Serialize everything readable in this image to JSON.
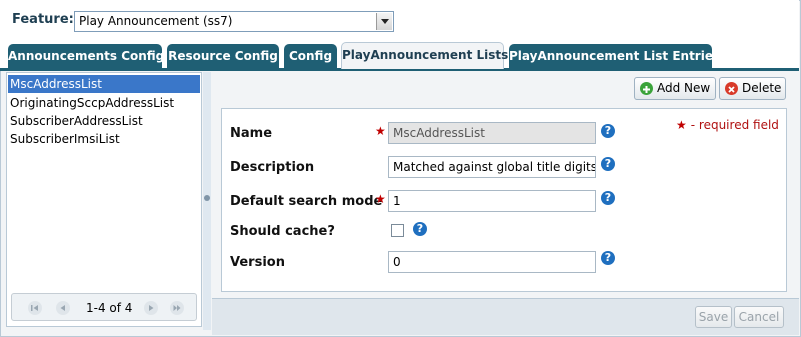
{
  "feature": {
    "label": "Feature:",
    "selected": "Play Announcement (ss7)"
  },
  "tabs": [
    {
      "label": "Announcements Config",
      "active": false
    },
    {
      "label": "Resource Config",
      "active": false
    },
    {
      "label": "Config",
      "active": false
    },
    {
      "label": "PlayAnnouncement Lists",
      "active": true
    },
    {
      "label": "PlayAnnouncement List Entries",
      "active": false
    }
  ],
  "list": {
    "items": [
      "MscAddressList",
      "OriginatingSccpAddressList",
      "SubscriberAddressList",
      "SubscriberImsiList"
    ],
    "selected_index": 0
  },
  "pager": {
    "text": "1-4 of 4"
  },
  "toolbar": {
    "add_label": "Add New",
    "delete_label": "Delete"
  },
  "form": {
    "required_note": "- required field",
    "required_star": "★",
    "help_glyph": "?",
    "fields": {
      "name": {
        "label": "Name",
        "value": "MscAddressList"
      },
      "description": {
        "label": "Description",
        "value": "Matched against global title digits of"
      },
      "default_search_mode": {
        "label": "Default search mode",
        "value": "1"
      },
      "should_cache": {
        "label": "Should cache?",
        "checked": false
      },
      "version": {
        "label": "Version",
        "value": "0"
      }
    }
  },
  "footer": {
    "save_label": "Save",
    "cancel_label": "Cancel"
  },
  "colors": {
    "tab_bg": "#1f5f74",
    "selection": "#3a77c9",
    "required": "#c00000",
    "help": "#1f6fbf",
    "add_icon": "#3aa33a",
    "delete_icon": "#d83a2a"
  }
}
